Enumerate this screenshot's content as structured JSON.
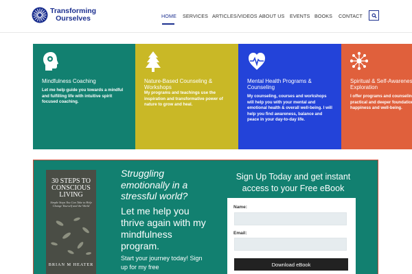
{
  "brand": {
    "line1": "Transforming",
    "line2": "Ourselves"
  },
  "nav": {
    "items": [
      {
        "label": "HOME"
      },
      {
        "label": "SERVICES"
      },
      {
        "label": "ARTICLES/VIDEOS"
      },
      {
        "label": "ABOUT US"
      },
      {
        "label": "EVENTS"
      },
      {
        "label": "BOOKS"
      },
      {
        "label": "CONTACT"
      }
    ],
    "active": "HOME"
  },
  "cards": [
    {
      "title": "Mindfulness Coaching",
      "desc": "Let me help guide you towards a mindful and fulfilling life with intuitive spirit focused coaching.",
      "color": "#128070",
      "icon": "head-icon"
    },
    {
      "title": "Nature-Based Counseling & Workshops",
      "desc": "My programs and teachings use the inspiration and transformative power of nature to grow and heal.",
      "color": "#c9b826",
      "icon": "tree-icon"
    },
    {
      "title": "Mental Health Programs & Counseling",
      "desc": "My counseling, courses and workshops will help you with your mental and emotional health & overall well-being. I will help you find awareness, balance and peace in your day-to-day life.",
      "color": "#2343d9",
      "icon": "heartbeat-icon"
    },
    {
      "title": "Spiritual & Self-Awareness Exploration",
      "desc": "I offer programs and counseling to explore a practical and deeper foundation for your happiness and well-being.",
      "color": "#e0603c",
      "icon": "burst-icon"
    }
  ],
  "promo": {
    "book_title": "30 STEPS TO CONSCIOUS LIVING",
    "book_subtitle": "Simple Steps You Can Take to Help Change Yourself and the World",
    "book_author": "BRIAN M HEATER",
    "headline": "Struggling emotionally in a stressful world?",
    "pitch": "Let me help you thrive again with my mindfulness program.",
    "cta_text": "Start your journey today! Sign up for my free",
    "signup_title": "Sign Up Today and get instant access to your Free eBook",
    "name_label": "Name:",
    "email_label": "Email:",
    "button_label": "Download eBook",
    "bg_color": "#128070"
  }
}
